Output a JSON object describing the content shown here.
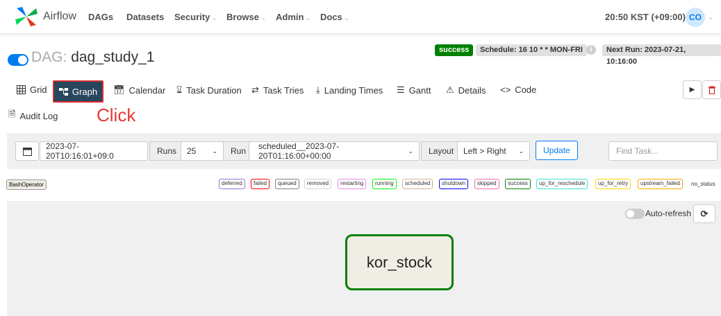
{
  "navbar": {
    "brand": "Airflow",
    "items": [
      "DAGs",
      "Datasets",
      "Security",
      "Browse",
      "Admin",
      "Docs"
    ],
    "time": "20:50 KST (+09:00)",
    "user_initials": "CO"
  },
  "dag": {
    "label": "DAG:",
    "dag_id": "dag_study_1",
    "status": "success",
    "schedule": "Schedule: 16 10 * * MON-FRI",
    "info_symbol": "i",
    "next_run": "Next Run: 2023-07-21, 10:16:00"
  },
  "tabs": {
    "grid": "Grid",
    "graph": "Graph",
    "calendar": "Calendar",
    "task_duration": "Task Duration",
    "task_tries": "Task Tries",
    "landing_times": "Landing Times",
    "gantt": "Gantt",
    "details": "Details",
    "code": "Code",
    "audit_log": "Audit Log"
  },
  "annotation": {
    "click": "Click"
  },
  "filters": {
    "base_date": "2023-07-20T10:16:01+09:0",
    "runs_label": "Runs",
    "runs_value": "25",
    "run_label": "Run",
    "run_value": "scheduled__2023-07-20T01:16:00+00:00",
    "layout_label": "Layout",
    "layout_value": "Left > Right",
    "update": "Update",
    "find_placeholder": "Find Task..."
  },
  "legend": {
    "operator": "BashOperator",
    "states": [
      {
        "name": "deferred",
        "color": "#9370db"
      },
      {
        "name": "failed",
        "color": "#ff0000"
      },
      {
        "name": "queued",
        "color": "#808080"
      },
      {
        "name": "removed",
        "color": "#d3d3d3"
      },
      {
        "name": "restarting",
        "color": "#ee82ee"
      },
      {
        "name": "running",
        "color": "#00ff00"
      },
      {
        "name": "scheduled",
        "color": "#d2b48c"
      },
      {
        "name": "shutdown",
        "color": "#0000ff"
      },
      {
        "name": "skipped",
        "color": "#ff69b4"
      },
      {
        "name": "success",
        "color": "#008000"
      },
      {
        "name": "up_for_reschedule",
        "color": "#40e0d0"
      },
      {
        "name": "up_for_retry",
        "color": "#ffd700"
      },
      {
        "name": "upstream_failed",
        "color": "#ffa500"
      }
    ],
    "no_status": "no_status"
  },
  "graph": {
    "auto_refresh": "Auto-refresh",
    "task": "kor_stock"
  },
  "colors": {
    "accent": "#017cee",
    "active_tab": "#28475d",
    "success": "#008000"
  }
}
